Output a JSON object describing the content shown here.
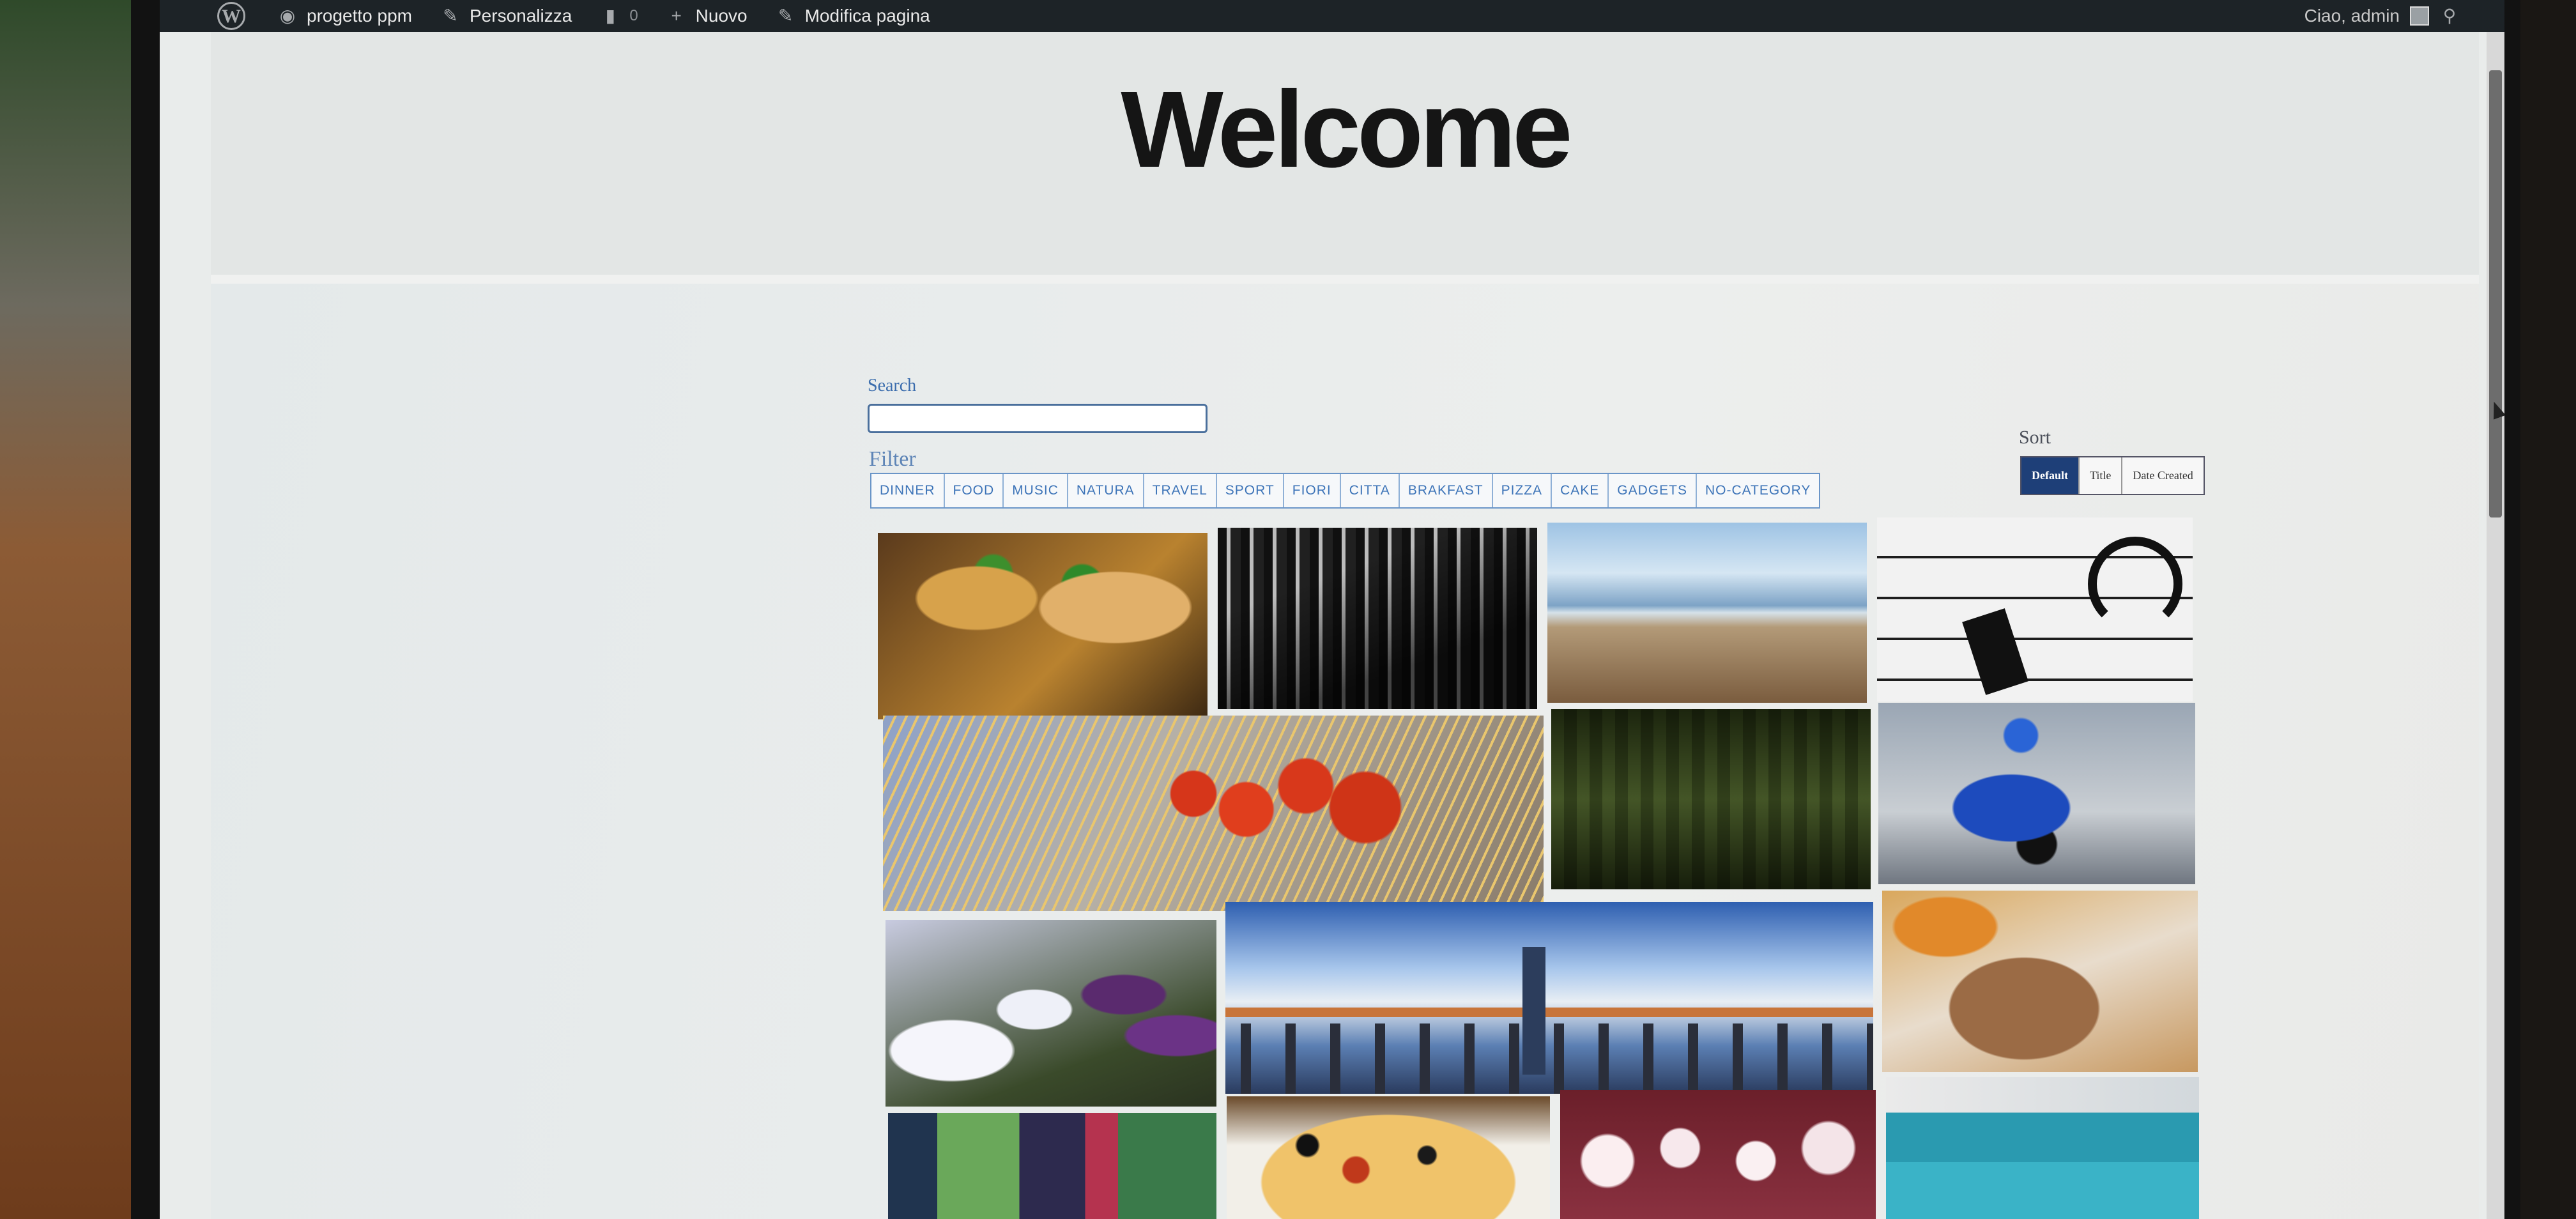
{
  "admin_bar": {
    "site_name": "progetto ppm",
    "customize": "Personalizza",
    "comments_count": "0",
    "new": "Nuovo",
    "edit_page": "Modifica pagina",
    "greeting": "Ciao, admin"
  },
  "page": {
    "title": "Welcome"
  },
  "search": {
    "label": "Search",
    "value": ""
  },
  "filter": {
    "label": "Filter",
    "categories": [
      "DINNER",
      "FOOD",
      "MUSIC",
      "NATURA",
      "TRAVEL",
      "SPORT",
      "FIORI",
      "CITTA",
      "BRAKFAST",
      "PIZZA",
      "CAKE",
      "GADGETS",
      "NO-CATEGORY"
    ]
  },
  "sort": {
    "label": "Sort",
    "options": [
      "Default",
      "Title",
      "Date Created"
    ],
    "selected": "Default"
  },
  "gallery": [
    {
      "icon": "burger-photo"
    },
    {
      "icon": "dj-mixer-photo"
    },
    {
      "icon": "sea-pier-photo"
    },
    {
      "icon": "headphones-phone-photo"
    },
    {
      "icon": "tomatoes-spaghetti-photo"
    },
    {
      "icon": "guitar-headstock-photo"
    },
    {
      "icon": "motorcycle-racer-photo"
    },
    {
      "icon": "tulips-photo"
    },
    {
      "icon": "city-skyline-photo"
    },
    {
      "icon": "breakfast-pastry-photo"
    },
    {
      "icon": "street-market-photo"
    },
    {
      "icon": "pizza-photo"
    },
    {
      "icon": "cupcakes-photo"
    },
    {
      "icon": "suitcases-photo"
    }
  ],
  "colors": {
    "admin_bar": "#1d2327",
    "filter_text": "#3d74b8",
    "sort_active": "#1e3f78"
  }
}
